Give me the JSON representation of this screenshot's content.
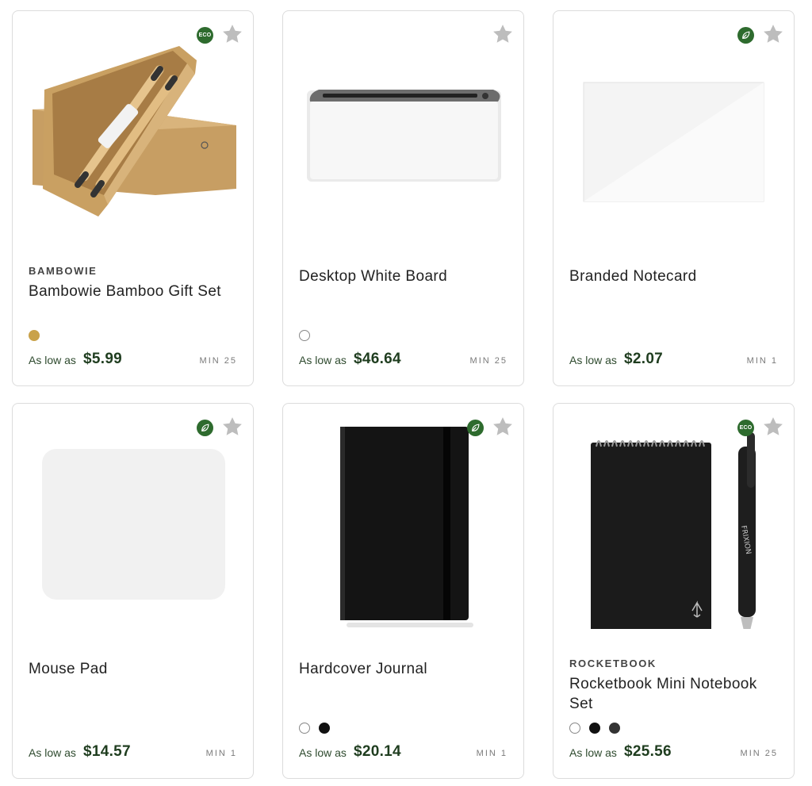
{
  "products": [
    {
      "brand": "BAMBOWIE",
      "title": "Bambowie Bamboo Gift Set",
      "badge": "ECO",
      "badge_icon": "eco-text-badge",
      "swatches": [
        "#c9a24a"
      ],
      "price_prefix": "As low as",
      "price": "$5.99",
      "min": "MIN 25"
    },
    {
      "brand": "",
      "title": "Desktop White Board",
      "badge": "",
      "swatches": [
        "#ffffff"
      ],
      "price_prefix": "As low as",
      "price": "$46.64",
      "min": "MIN 25"
    },
    {
      "brand": "",
      "title": "Branded Notecard",
      "badge": "leaf",
      "badge_icon": "leaf-icon",
      "swatches": [],
      "price_prefix": "As low as",
      "price": "$2.07",
      "min": "MIN 1"
    },
    {
      "brand": "",
      "title": "Mouse Pad",
      "badge": "leaf",
      "badge_icon": "leaf-icon",
      "swatches": [],
      "price_prefix": "As low as",
      "price": "$14.57",
      "min": "MIN 1"
    },
    {
      "brand": "",
      "title": "Hardcover Journal",
      "badge": "leaf",
      "badge_icon": "leaf-icon",
      "swatches": [
        "#ffffff",
        "#111111"
      ],
      "price_prefix": "As low as",
      "price": "$20.14",
      "min": "MIN 1"
    },
    {
      "brand": "ROCKETBOOK",
      "title": "Rocketbook Mini Notebook Set",
      "badge": "ECO",
      "badge_icon": "eco-text-badge",
      "swatches": [
        "#ffffff",
        "#111111",
        "#333333"
      ],
      "price_prefix": "As low as",
      "price": "$25.56",
      "min": "MIN 25"
    }
  ],
  "colors": {
    "eco_green": "#2e6b2e",
    "price_green": "#1f3d1f",
    "favorite_star": "#bdbdbd",
    "card_border": "#dcdcdc"
  },
  "icons": {
    "favorite": "star-icon"
  }
}
